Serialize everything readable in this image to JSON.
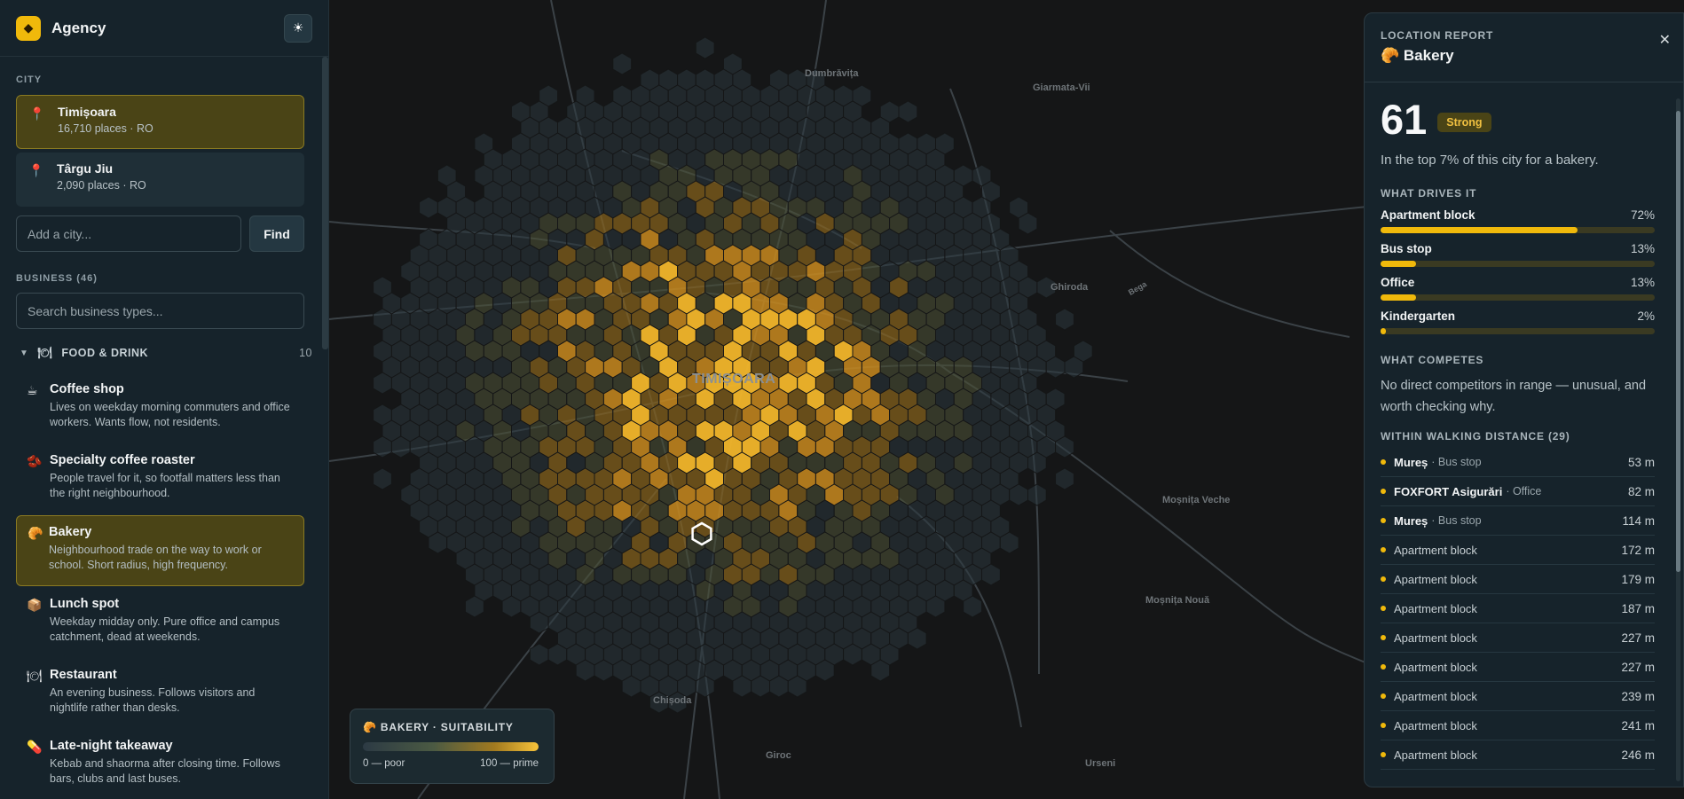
{
  "app": {
    "title": "Agency",
    "theme_toggle_icon": "sun-icon"
  },
  "city_section": {
    "label": "CITY",
    "cities": [
      {
        "name": "Timișoara",
        "meta": "16,710 places · RO"
      },
      {
        "name": "Târgu Jiu",
        "meta": "2,090 places · RO"
      }
    ],
    "add_placeholder": "Add a city...",
    "find_label": "Find"
  },
  "business_section": {
    "label": "BUSINESS (46)",
    "search_placeholder": "Search business types...",
    "group": {
      "label": "FOOD & DRINK",
      "count": "10"
    },
    "items": [
      {
        "icon": "☕",
        "name": "Coffee shop",
        "desc": "Lives on weekday morning commuters and office workers. Wants flow, not residents."
      },
      {
        "icon": "🫘",
        "name": "Specialty coffee roaster",
        "desc": "People travel for it, so footfall matters less than the right neighbourhood."
      },
      {
        "icon": "🥐",
        "name": "Bakery",
        "desc": "Neighbourhood trade on the way to work or school. Short radius, high frequency."
      },
      {
        "icon": "📦",
        "name": "Lunch spot",
        "desc": "Weekday midday only. Pure office and campus catchment, dead at weekends."
      },
      {
        "icon": "🍽",
        "name": "Restaurant",
        "desc": "An evening business. Follows visitors and nightlife rather than desks."
      },
      {
        "icon": "💊",
        "name": "Late-night takeaway",
        "desc": "Kebab and shaorma after closing time. Follows bars, clubs and last buses."
      }
    ]
  },
  "map": {
    "labels": {
      "city": "TIMIȘOARA",
      "dumbravita": "Dumbrăvița",
      "giarmata": "Giarmata-Vii",
      "ghiroda": "Ghiroda",
      "mosnita_veche": "Moșnița Veche",
      "mosnita_noua": "Moșnița Nouă",
      "chisoda": "Chișoda",
      "giroc": "Giroc",
      "urseni": "Urseni",
      "bega": "Bega"
    },
    "legend": {
      "title": "BAKERY · SUITABILITY",
      "low": "0 — poor",
      "high": "100 — prime"
    }
  },
  "report": {
    "kicker": "LOCATION REPORT",
    "title": "Bakery",
    "score": "61",
    "badge": "Strong",
    "blurb": "In the top 7% of this city for a bakery.",
    "drives_label": "WHAT DRIVES IT",
    "drivers": [
      {
        "name": "Apartment block",
        "pct": "72%",
        "value": 0.72
      },
      {
        "name": "Bus stop",
        "pct": "13%",
        "value": 0.13
      },
      {
        "name": "Office",
        "pct": "13%",
        "value": 0.13
      },
      {
        "name": "Kindergarten",
        "pct": "2%",
        "value": 0.02
      }
    ],
    "competes_label": "WHAT COMPETES",
    "competes_text": "No direct competitors in range — unusual, and worth checking why.",
    "walking_label": "WITHIN WALKING DISTANCE (29)",
    "nearby": [
      {
        "name": "Mureș",
        "type": "· Bus stop",
        "dist": "53 m",
        "named": true
      },
      {
        "name": "FOXFORT Asigurări",
        "type": "· Office",
        "dist": "82 m",
        "named": true
      },
      {
        "name": "Mureș",
        "type": "· Bus stop",
        "dist": "114 m",
        "named": true
      },
      {
        "name": "Apartment block",
        "type": "",
        "dist": "172 m",
        "named": false
      },
      {
        "name": "Apartment block",
        "type": "",
        "dist": "179 m",
        "named": false
      },
      {
        "name": "Apartment block",
        "type": "",
        "dist": "187 m",
        "named": false
      },
      {
        "name": "Apartment block",
        "type": "",
        "dist": "227 m",
        "named": false
      },
      {
        "name": "Apartment block",
        "type": "",
        "dist": "227 m",
        "named": false
      },
      {
        "name": "Apartment block",
        "type": "",
        "dist": "239 m",
        "named": false
      },
      {
        "name": "Apartment block",
        "type": "",
        "dist": "241 m",
        "named": false
      },
      {
        "name": "Apartment block",
        "type": "",
        "dist": "246 m",
        "named": false
      }
    ]
  }
}
